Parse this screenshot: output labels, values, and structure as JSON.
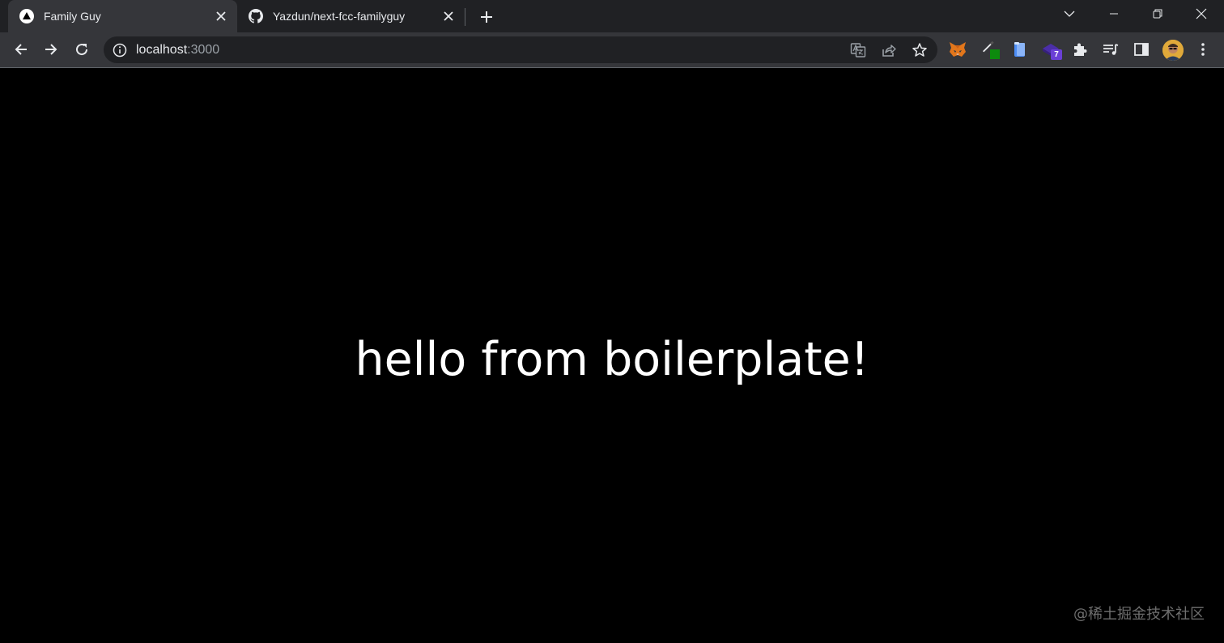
{
  "browser": {
    "tabs": [
      {
        "title": "Family Guy",
        "favicon": "nextjs-triangle-icon",
        "active": true
      },
      {
        "title": "Yazdun/next-fcc-familyguy",
        "favicon": "github-icon",
        "active": false
      }
    ],
    "address_bar": {
      "host": "localhost",
      "port": ":3000"
    },
    "extensions": [
      "metamask-fox-icon",
      "color-picker-icon",
      "clipboard-icon",
      "purple-extension-icon",
      "puzzle-extensions-icon",
      "media-playlist-icon",
      "side-panel-icon"
    ],
    "extension_badge": "7"
  },
  "page": {
    "heading": "hello from boilerplate!",
    "watermark": "@稀土掘金技术社区"
  },
  "colors": {
    "tabstrip_bg": "#202124",
    "toolbar_bg": "#35363a",
    "omnibox_bg": "#202124",
    "page_bg": "#000000",
    "text": "#ffffff"
  }
}
